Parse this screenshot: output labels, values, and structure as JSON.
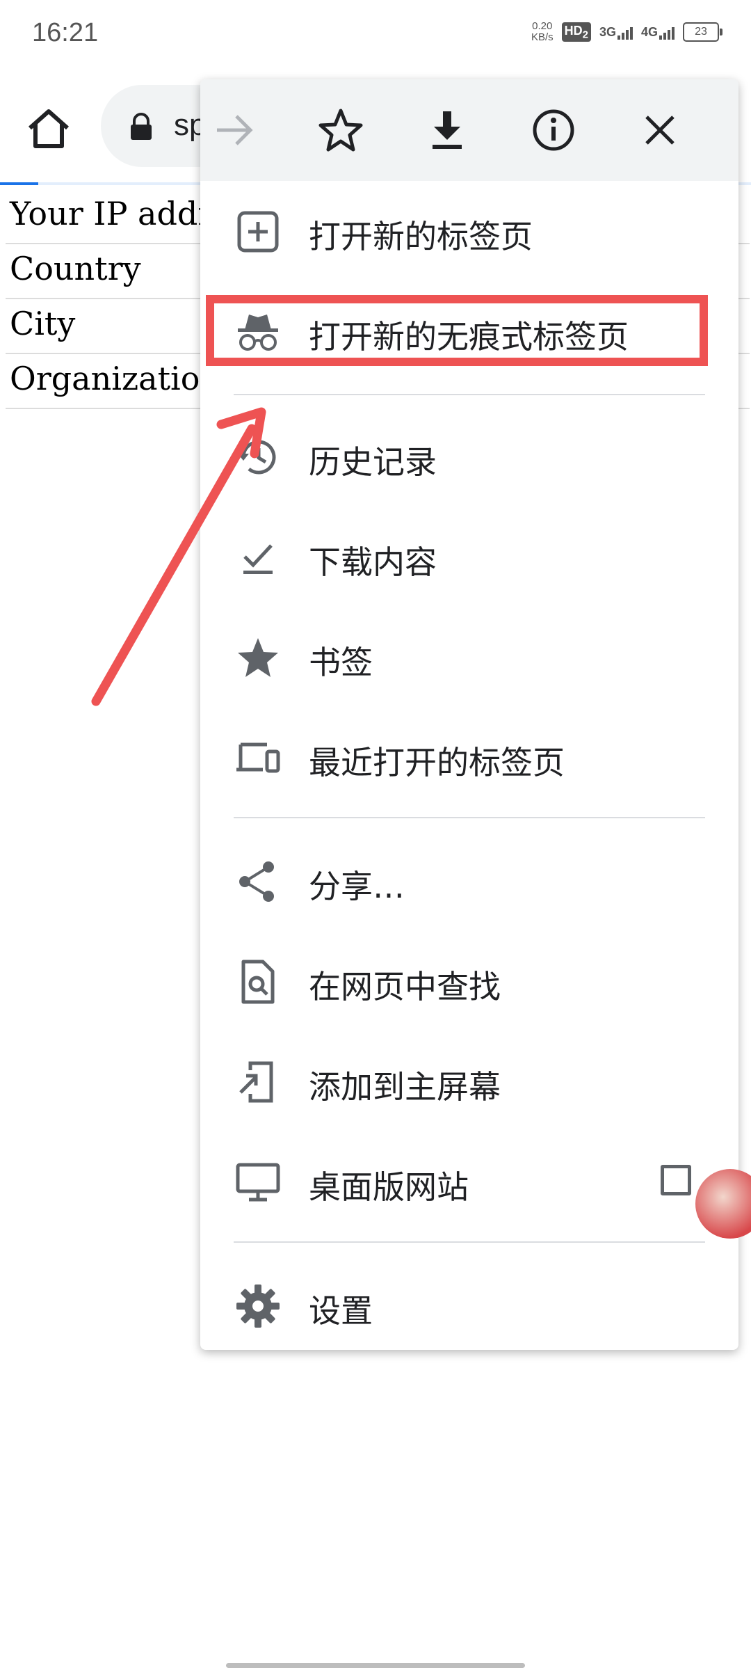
{
  "status_bar": {
    "time": "16:21",
    "speed_value": "0.20",
    "speed_unit": "KB/s",
    "hd_label": "HD",
    "hd_sub": "2",
    "net1": "3G",
    "net2": "4G",
    "battery": "23"
  },
  "toolbar": {
    "url_partial": "sp"
  },
  "page": {
    "rows": [
      "Your IP addr",
      "Country",
      "City",
      "Organization"
    ]
  },
  "menu": {
    "top_icons": [
      "forward-icon",
      "star-outline-icon",
      "download-icon",
      "info-icon",
      "close-icon"
    ],
    "items": [
      {
        "label": "打开新的标签页",
        "icon": "new-tab-icon"
      },
      {
        "label": "打开新的无痕式标签页",
        "icon": "incognito-icon"
      },
      {
        "label": "历史记录",
        "icon": "history-icon"
      },
      {
        "label": "下载内容",
        "icon": "downloads-check-icon"
      },
      {
        "label": "书签",
        "icon": "bookmark-star-icon"
      },
      {
        "label": "最近打开的标签页",
        "icon": "devices-icon"
      },
      {
        "label": "分享…",
        "icon": "share-icon"
      },
      {
        "label": "在网页中查找",
        "icon": "find-in-page-icon"
      },
      {
        "label": "添加到主屏幕",
        "icon": "add-to-home-icon"
      },
      {
        "label": "桌面版网站",
        "icon": "desktop-icon"
      },
      {
        "label": "设置",
        "icon": "settings-gear-icon"
      }
    ],
    "desktop_site_checked": false
  },
  "colors": {
    "annotation": "#ee5353",
    "icon_gray": "#5f6368",
    "menu_header_bg": "#f1f3f4"
  }
}
